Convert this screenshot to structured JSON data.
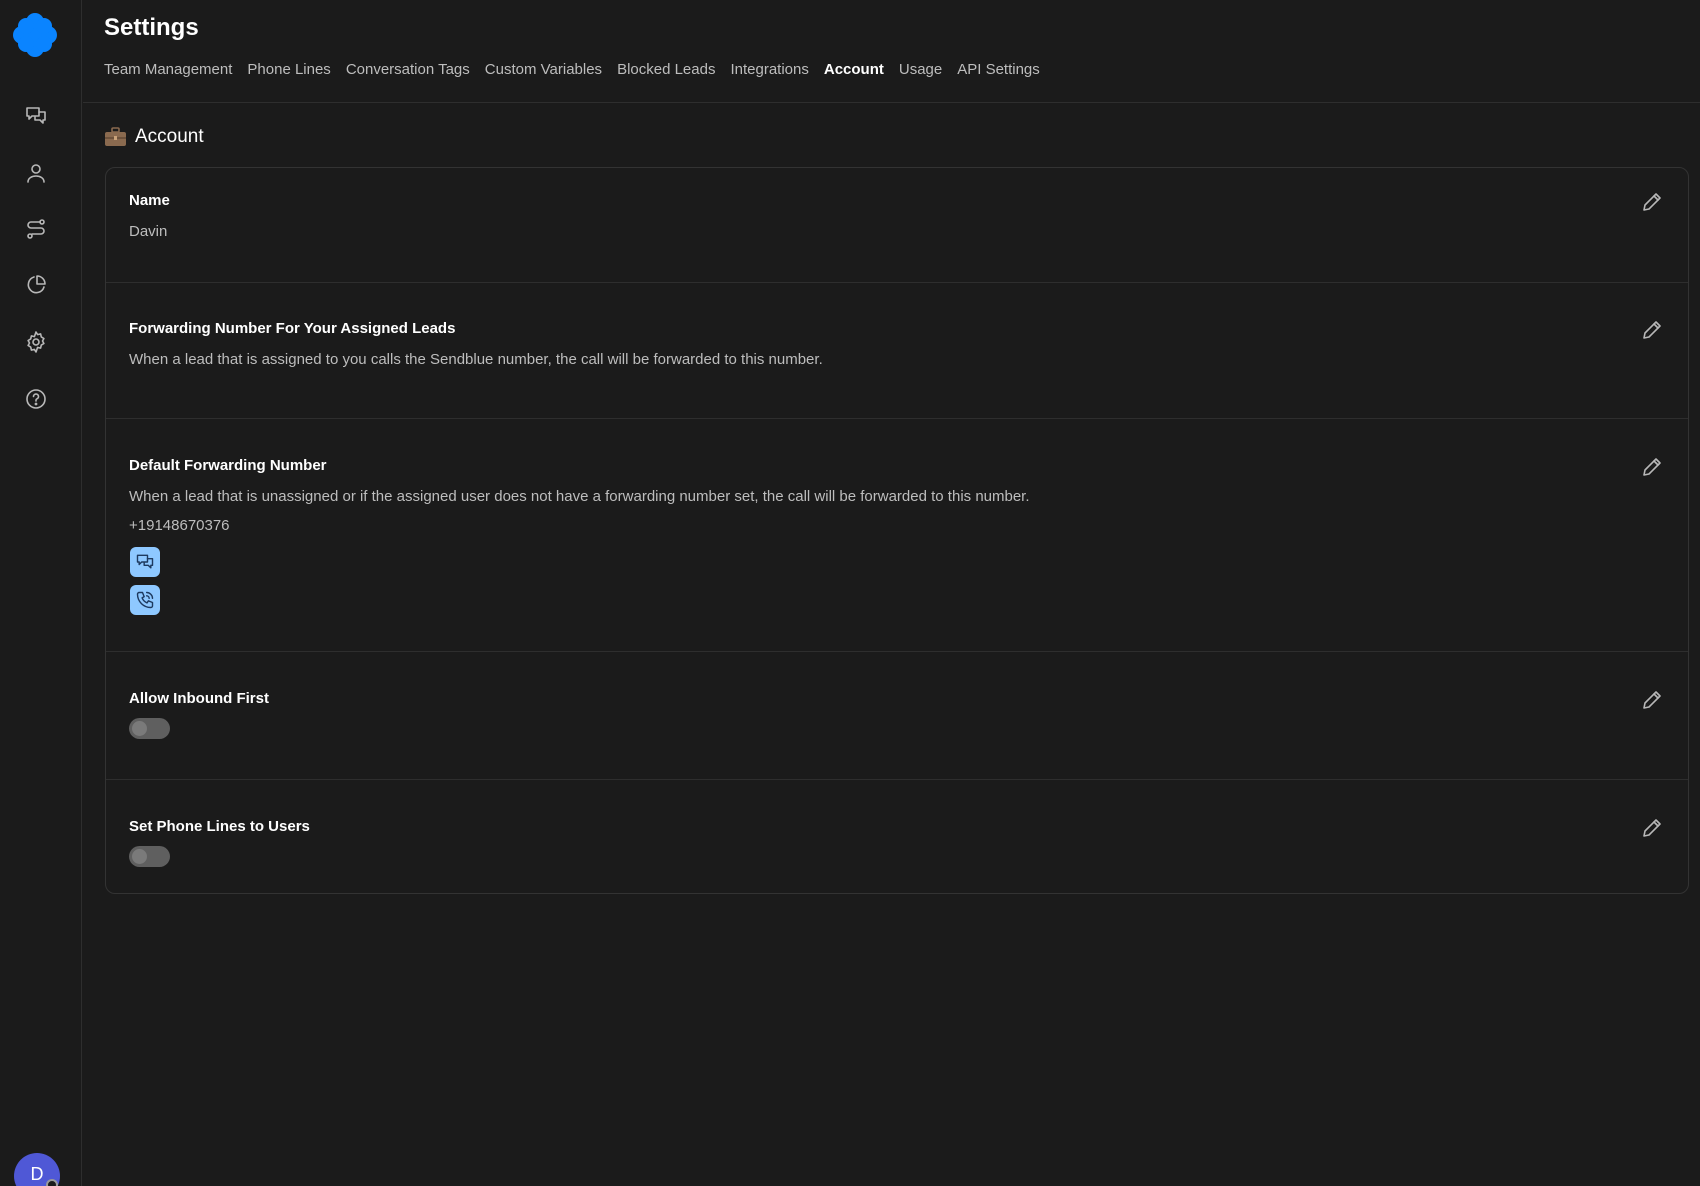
{
  "sidebar": {
    "icons": [
      "chat-bubbles-icon",
      "user-icon",
      "routing-icon",
      "pie-chart-icon",
      "gear-icon",
      "help-circle-icon"
    ],
    "avatar_initial": "D",
    "brand_color": "#0a84ff"
  },
  "header": {
    "title": "Settings",
    "tabs": [
      {
        "label": "Team Management",
        "active": false
      },
      {
        "label": "Phone Lines",
        "active": false
      },
      {
        "label": "Conversation Tags",
        "active": false
      },
      {
        "label": "Custom Variables",
        "active": false
      },
      {
        "label": "Blocked Leads",
        "active": false
      },
      {
        "label": "Integrations",
        "active": false
      },
      {
        "label": "Account",
        "active": true
      },
      {
        "label": "Usage",
        "active": false
      },
      {
        "label": "API Settings",
        "active": false
      }
    ]
  },
  "section": {
    "icon": "briefcase-icon",
    "title": "Account"
  },
  "settings": {
    "name": {
      "label": "Name",
      "value": "Davin"
    },
    "assigned_forwarding": {
      "label": "Forwarding Number For Your Assigned Leads",
      "description": "When a lead that is assigned to you calls the Sendblue number, the call will be forwarded to this number."
    },
    "default_forwarding": {
      "label": "Default Forwarding Number",
      "description": "When a lead that is unassigned or if the assigned user does not have a forwarding number set, the call will be forwarded to this number.",
      "number": "+19148670376",
      "actions": [
        "chat-icon",
        "phone-call-icon"
      ]
    },
    "allow_inbound_first": {
      "label": "Allow Inbound First",
      "enabled": false
    },
    "set_phone_lines": {
      "label": "Set Phone Lines to Users",
      "enabled": false
    }
  }
}
